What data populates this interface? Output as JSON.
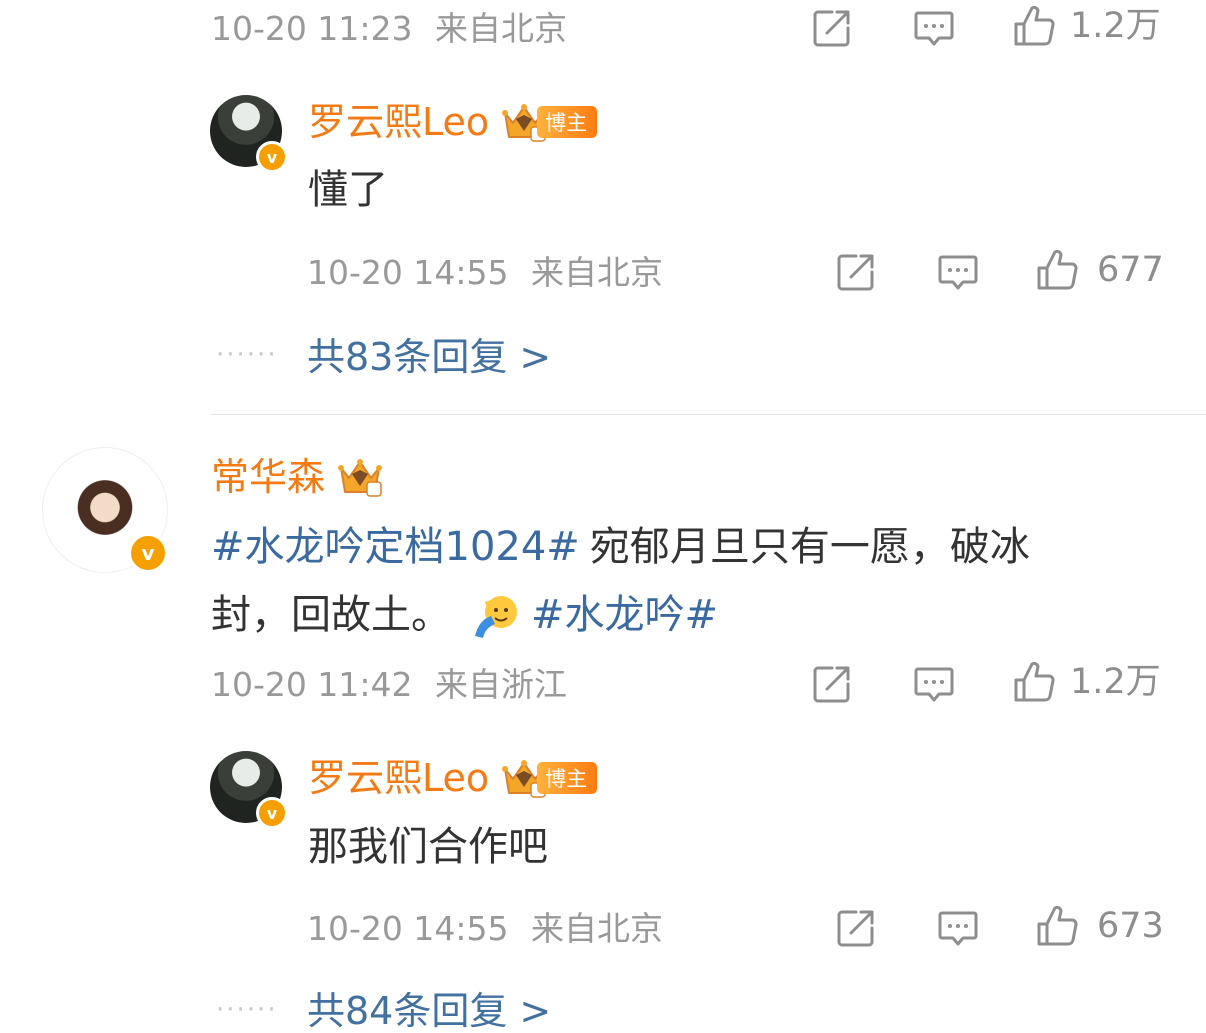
{
  "colors": {
    "username": "#f47b14",
    "topic": "#3a6aa0",
    "more_link": "#42709f",
    "meta": "#999999",
    "verified_badge": "#f5a000"
  },
  "icons": {
    "repost": "share-square-icon",
    "comment": "comment-bubble-icon",
    "like": "thumbs-up-icon",
    "crown": "crown-level-icon",
    "emoji": "saluting-face-emoji"
  },
  "comment_top": {
    "time": "10-20 11:23",
    "location": "来自北京",
    "like_count": "1.2万",
    "reply": {
      "username": "罗云熙Leo",
      "badge_level": "9",
      "badge_label": "博主",
      "text": "懂了",
      "time": "10-20 14:55",
      "location": "来自北京",
      "like_count": "677"
    },
    "more_replies": "共83条回复 >"
  },
  "comment_main": {
    "username": "常华森",
    "badge_level": "8",
    "topic1": "#水龙吟定档1024#",
    "text1": "宛郁月旦只有一愿，破冰",
    "text2": "封，回故土。",
    "topic2": "#水龙吟#",
    "time": "10-20 11:42",
    "location": "来自浙江",
    "like_count": "1.2万",
    "reply": {
      "username": "罗云熙Leo",
      "badge_level": "9",
      "badge_label": "博主",
      "text": "那我们合作吧",
      "time": "10-20 14:55",
      "location": "来自北京",
      "like_count": "673"
    },
    "more_replies": "共84条回复 >"
  }
}
